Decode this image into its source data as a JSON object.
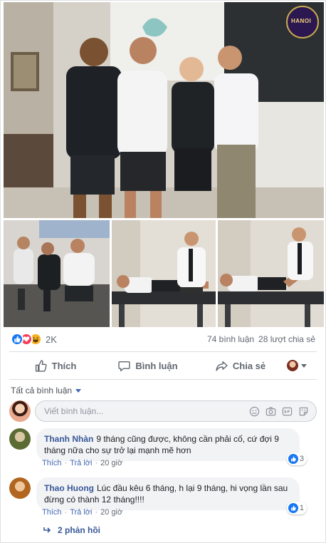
{
  "logo_text": "HANOI",
  "reactions": {
    "count": "2K"
  },
  "stats": {
    "comments": "74 bình luận",
    "shares": "28 lượt chia sẻ"
  },
  "actions": {
    "like": "Thích",
    "comment": "Bình luận",
    "share": "Chia sẻ"
  },
  "comment_filter": "Tất cả bình luận",
  "write_comment": {
    "placeholder": "Viết bình luận..."
  },
  "comments": [
    {
      "name": "Thanh Nhàn",
      "text": "9 tháng cũng được, không cần phải cố, cứ đợi 9 tháng nữa cho sự trở lại mạnh mẽ hơn",
      "like_label": "Thích",
      "reply_label": "Trả lời",
      "time": "20 giờ",
      "reactions": "3"
    },
    {
      "name": "Thao Huong",
      "text": "Lúc đầu kêu 6 tháng, h lại 9 tháng, hi vọng lần sau đừng có thành 12 tháng!!!!",
      "like_label": "Thích",
      "reply_label": "Trả lời",
      "time": "20 giờ",
      "reactions": "1"
    }
  ],
  "replies_link": "2 phản hồi",
  "colors": {
    "accent": "#4267b2",
    "link": "#385898",
    "like_blue": "#1877f2",
    "love_red": "#f33e58",
    "haha_yellow": "#f7b125"
  }
}
